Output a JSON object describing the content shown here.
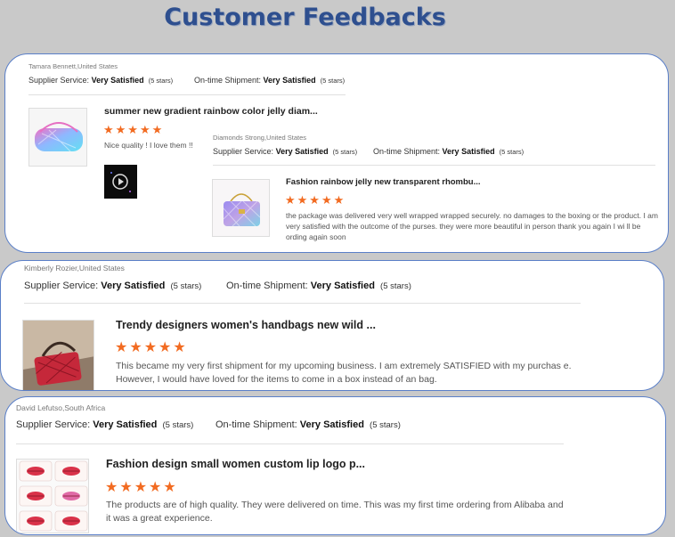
{
  "page_title": "Customer Feedbacks",
  "labels": {
    "supplier": "Supplier Service:",
    "shipment": "On-time Shipment:",
    "value": "Very Satisfied",
    "stars": "(5 stars)"
  },
  "stars_glyph": "★★★★★",
  "reviews": [
    {
      "reviewer": "Tamara Bennett,United States",
      "product": "summer new gradient rainbow color jelly diam...",
      "rating": 5,
      "text": "Nice quality ! I love them !!"
    },
    {
      "reviewer": "Diamonds Strong,United States",
      "product": "Fashion rainbow jelly new transparent rhombu...",
      "rating": 5,
      "text": "the package was delivered very well wrapped wrapped securely.  no damages to the boxing or the product. I am very satisfied with the outcome of the purses. they were more beautiful in person  thank you again I wi ll be ording again soon"
    },
    {
      "reviewer": "Kimberly Rozier,United States",
      "product": "Trendy designers women's handbags new wild ...",
      "rating": 5,
      "text": "This became my very first shipment for my upcoming business. I am extremely SATISFIED with my purchas e. However, I would have loved for the items to come in a box instead of an bag."
    },
    {
      "reviewer": "David Lefutso,South Africa",
      "product": "Fashion design small women custom lip logo p...",
      "rating": 5,
      "text": "The products are of high quality. They were delivered on time. This was my first time ordering from Alibaba and it was a great experience."
    }
  ]
}
